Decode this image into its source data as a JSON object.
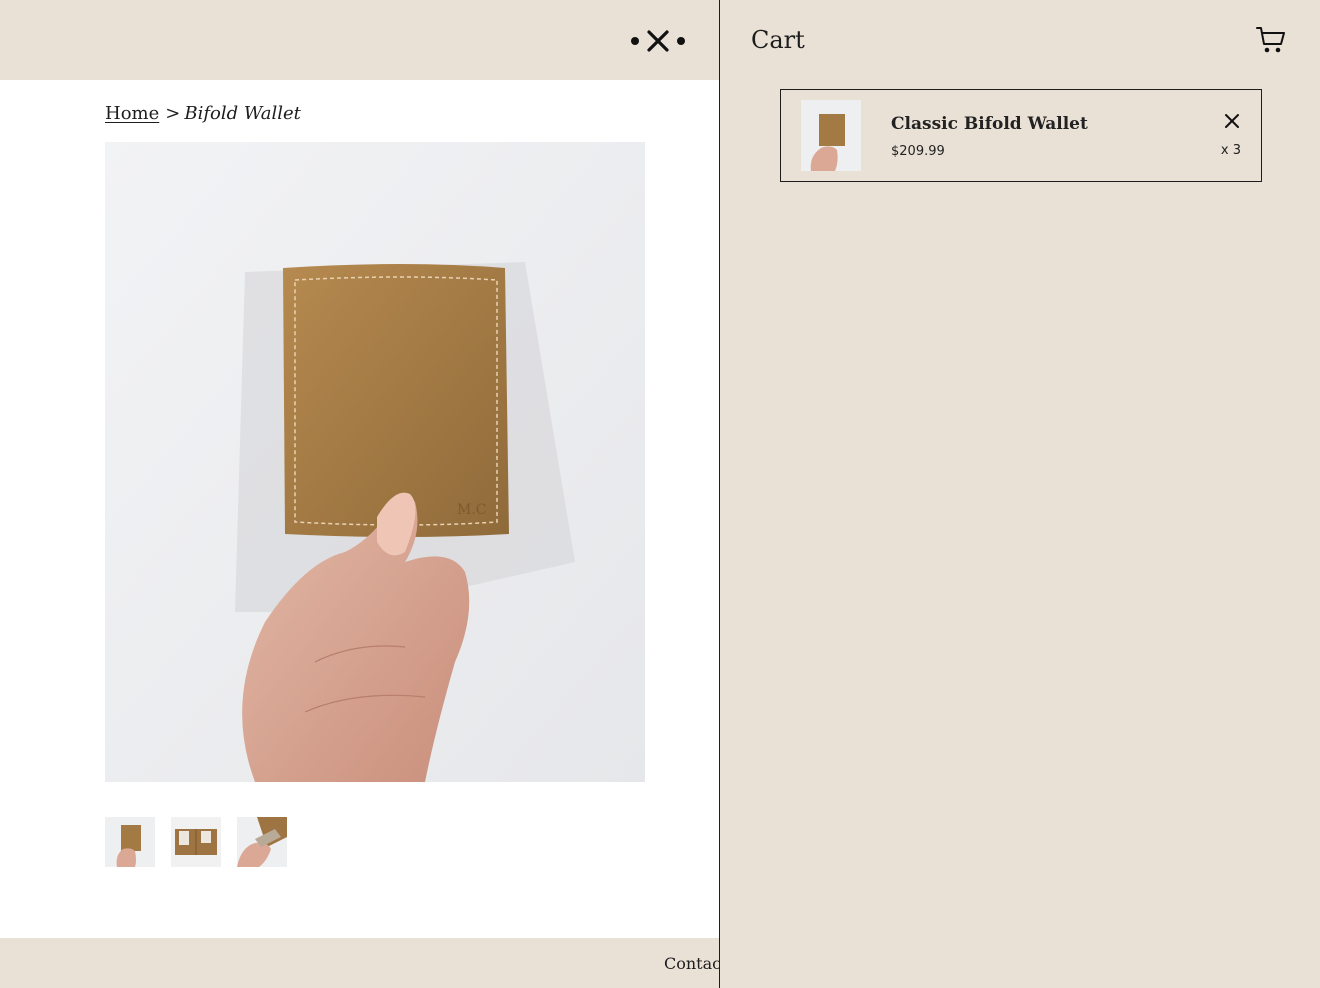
{
  "breadcrumb": {
    "home": "Home",
    "separator": ">",
    "current": "Bifold Wallet"
  },
  "product": {
    "main_image": "wallet-in-hand-photo",
    "thumbnails": [
      "wallet-front-thumb",
      "wallet-open-thumb",
      "wallet-side-thumb"
    ]
  },
  "footer": {
    "contact": "Contact"
  },
  "cart": {
    "title": "Cart",
    "items": [
      {
        "name": "Classic Bifold Wallet",
        "price": "$209.99",
        "quantity": "x 3"
      }
    ]
  },
  "colors": {
    "panel_background": "#e9e0d6",
    "page_background": "#ffffff",
    "text": "#1d1d1d",
    "leather": "#a37a44"
  },
  "icons": [
    "logo-dot-icon",
    "logo-cross-icon",
    "cart-icon",
    "close-icon"
  ]
}
